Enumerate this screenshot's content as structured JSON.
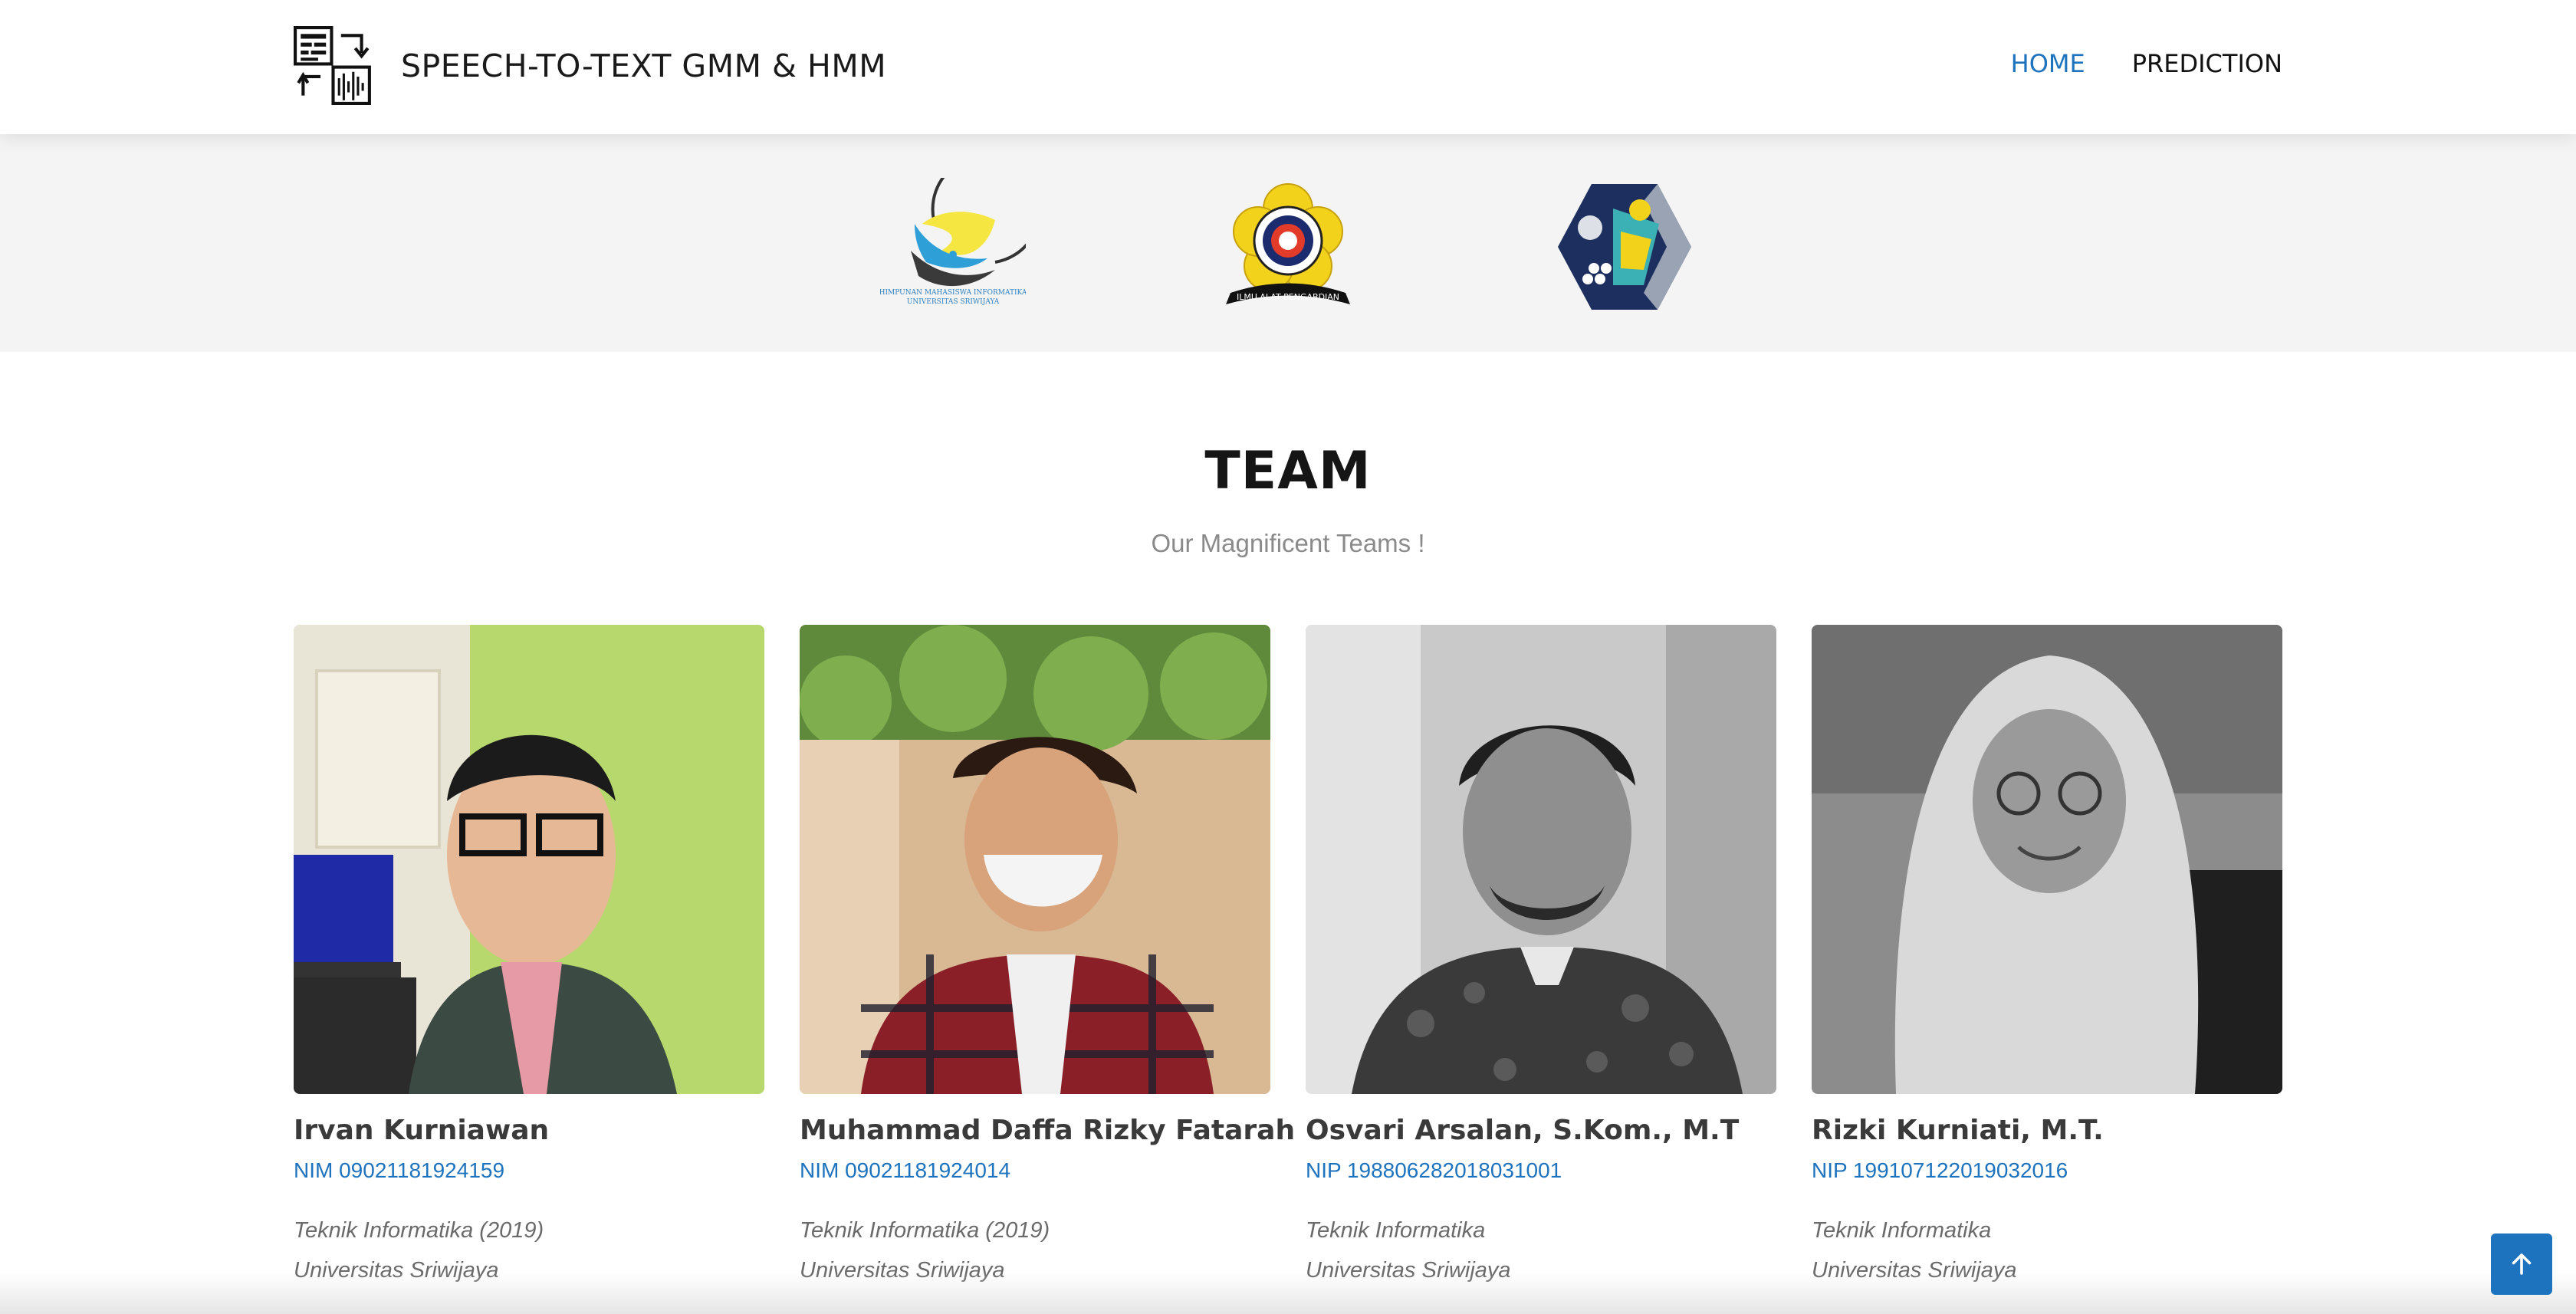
{
  "navbar": {
    "brand_title": "SPEECH-TO-TEXT GMM & HMM",
    "brand_icon": "speech-to-text-icon",
    "links": [
      {
        "label": "HOME",
        "active": true
      },
      {
        "label": "PREDICTION",
        "active": false
      }
    ],
    "active_color": "#1e73be"
  },
  "logos": [
    {
      "name": "himpunan-mahasiswa-informatika-logo",
      "caption_line1": "HIMPUNAN MAHASISWA INFORMATIKA",
      "caption_line2": "UNIVERSITAS SRIWIJAYA"
    },
    {
      "name": "universitas-sriwijaya-logo",
      "ribbon_text": "ILMU ALAT PENGABDIAN"
    },
    {
      "name": "fasilkom-hexagon-logo"
    }
  ],
  "team": {
    "title": "TEAM",
    "subtitle": "Our Magnificent Teams !",
    "members": [
      {
        "name": "Irvan Kurniawan",
        "id": "NIM 09021181924159",
        "info_line1": "Teknik Informatika (2019)",
        "info_line2": "Universitas Sriwijaya",
        "photo": "portrait-irvan"
      },
      {
        "name": "Muhammad Daffa Rizky Fatarah",
        "id": "NIM 09021181924014",
        "info_line1": "Teknik Informatika (2019)",
        "info_line2": "Universitas Sriwijaya",
        "photo": "portrait-daffa"
      },
      {
        "name": "Osvari Arsalan, S.Kom., M.T",
        "id": "NIP 198806282018031001",
        "info_line1": "Teknik Informatika",
        "info_line2": "Universitas Sriwijaya",
        "photo": "portrait-osvari"
      },
      {
        "name": "Rizki Kurniati, M.T.",
        "id": "NIP 199107122019032016",
        "info_line1": "Teknik Informatika",
        "info_line2": "Universitas Sriwijaya",
        "photo": "portrait-rizki"
      }
    ]
  },
  "back_to_top": {
    "icon": "arrow-up-icon",
    "color": "#1e73be"
  }
}
